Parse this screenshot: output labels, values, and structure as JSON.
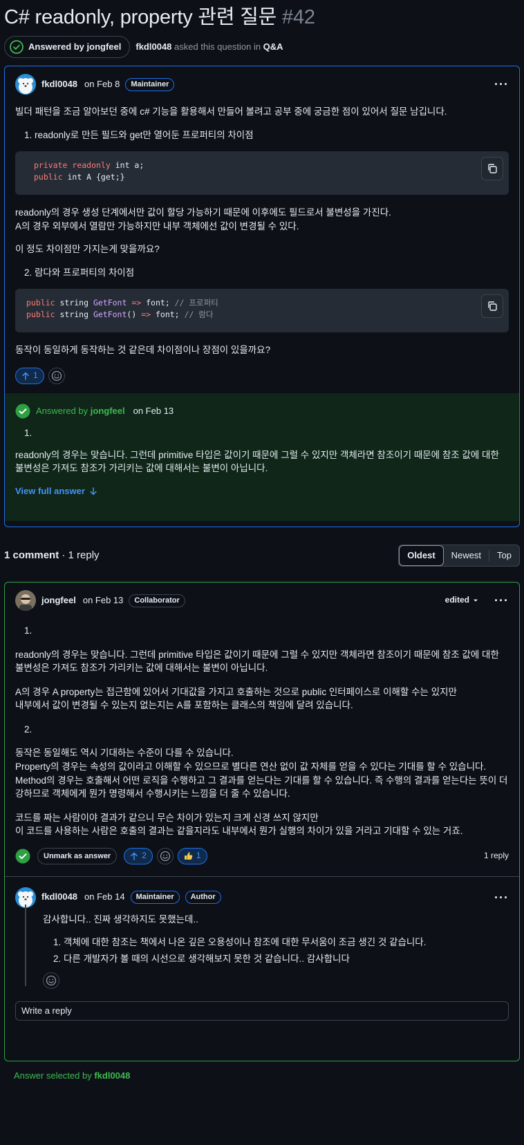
{
  "title": {
    "text": "C# readonly, property 관련 질문",
    "number": "#42"
  },
  "meta": {
    "answered_label": "Answered by jongfeel",
    "author": "fkdl0048",
    "asked_text": " asked this question in ",
    "category": "Q&A"
  },
  "question": {
    "user": "fkdl0048",
    "date": "on Feb 8",
    "role": "Maintainer",
    "intro": "빌더 패턴을 조금 알아보던 중에 c# 기능을 활용해서 만들어 볼려고 공부 중에 궁금한 점이 있어서 질문 남깁니다.",
    "item1": "1. readonly로 만든 필드와 get만 열어둔 프로퍼티의 차이점",
    "code1": {
      "l1_kw1": "private",
      "l1_kw2": "readonly",
      "l1_rest": " int a;",
      "l2_kw": "public",
      "l2_rest": " int A {get;}"
    },
    "p1": "readonly의 경우 생성 단계에서만 값이 할당 가능하기 때문에 이후에도 필드로서 불변성을 가진다.",
    "p2": "A의 경우 외부에서 열람만 가능하지만 내부 객체에선 값이 변경될 수 있다.",
    "p3": "이 정도 차이점만 가지는게 맞을까요?",
    "item2": "2. 람다와 프로퍼티의 차이점",
    "code2": {
      "l1_kw": "public",
      "l1_t": " string ",
      "l1_fn": "GetFont",
      "l1_op": " =>",
      "l1_rest": " font; ",
      "l1_cm": "// 프로퍼티",
      "l2_kw": "public",
      "l2_t": " string ",
      "l2_fn": "GetFont",
      "l2_paren": "()",
      "l2_op": " =>",
      "l2_rest": " font; ",
      "l2_cm": "// 람다"
    },
    "p4": "동작이 동일하게 동작하는 것 같은데 차이점이나 장점이 있을까요?",
    "upvotes": "1"
  },
  "answer_preview": {
    "label": "Answered by ",
    "user": "jongfeel",
    "date": "on Feb 13",
    "item": "1.",
    "text": "readonly의 경우는 맞습니다. 그런데 primitive 타입은 값이기 때문에 그럴 수 있지만 객체라면 참조이기 때문에 참조 값에 대한 불변성은 가져도 참조가 가리키는 값에 대해서는 불변이 아닙니다.",
    "view_full": "View full answer"
  },
  "comments_header": {
    "count": "1 comment",
    "replies": " · 1 reply",
    "tabs": [
      "Oldest",
      "Newest",
      "Top"
    ]
  },
  "comment": {
    "user": "jongfeel",
    "date": "on Feb 13",
    "role": "Collaborator",
    "edited": "edited",
    "n1": "1.",
    "c1": "readonly의 경우는 맞습니다. 그런데 primitive 타입은 값이기 때문에 그럴 수 있지만 객체라면 참조이기 때문에 참조 값에 대한 불변성은 가져도 참조가 가리키는 값에 대해서는 불변이 아닙니다.",
    "c2a": "A의 경우 A property는 접근함에 있어서 기대값을 가지고 호출하는 것으로 public 인터페이스로 이해할 수는 있지만",
    "c2b": "내부에서 값이 변경될 수 있는지 없는지는 A를 포함하는 클래스의 책임에 달려 있습니다.",
    "n2": "2.",
    "c3a": "동작은 동일해도 역시 기대하는 수준이 다를 수 있습니다.",
    "c3b": "Property의 경우는 속성의 값이라고 이해할 수 있으므로 별다른 연산 없이 값 자체를 얻을 수 있다는 기대를 할 수 있습니다.",
    "c3c": "Method의 경우는 호출해서 어떤 로직을 수행하고 그 결과를 얻는다는 기대를 할 수 있습니다. 즉 수행의 결과를 얻는다는 뜻이 더 강하므로 객체에게 뭔가 명령해서 수행시키는 느낌을 더 줄 수 있습니다.",
    "c4a": "코드를 짜는 사람이야 결과가 같으니 무슨 차이가 있는지 크게 신경 쓰지 않지만",
    "c4b": "이 코드를 사용하는 사람은 호출의 결과는 같을지라도 내부에서 뭔가 실행의 차이가 있을 거라고 기대할 수 있는 거죠.",
    "unmark": "Unmark as answer",
    "upvotes": "2",
    "thumbs": "1",
    "reply_count": "1 reply"
  },
  "reply": {
    "user": "fkdl0048",
    "date": "on Feb 14",
    "role1": "Maintainer",
    "role2": "Author",
    "text": "감사합니다.. 진짜 생각하지도 못했는데..",
    "li1": "객체에 대한 참조는 책에서 나온 깊은 오용성이나 참조에 대한 무서움이 조금 생긴 것 같습니다.",
    "li2": "다른 개발자가 볼 때의 시선으로 생각해보지 못한 것 같습니다.. 감사합니다",
    "placeholder": "Write a reply"
  },
  "footer": {
    "label": "Answer selected by ",
    "user": "fkdl0048"
  },
  "colors": {
    "bg": "#0d1117",
    "accent_blue": "#1f6feb",
    "accent_green": "#2ea043",
    "answer_bg": "#0f2619"
  }
}
